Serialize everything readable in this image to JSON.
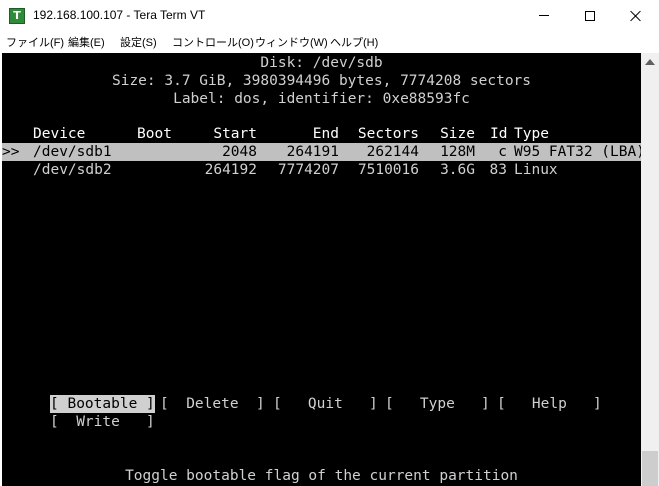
{
  "window": {
    "title": "192.168.100.107 - Tera Term VT",
    "icon_letter": "T"
  },
  "menu": [
    {
      "label": "ファイル(F)"
    },
    {
      "label": "編集(E)"
    },
    {
      "label": "設定(S)"
    },
    {
      "label": "コントロール(O)"
    },
    {
      "label": "ウィンドウ(W)"
    },
    {
      "label": "ヘルプ(H)"
    }
  ],
  "disk": {
    "line1": "Disk: /dev/sdb",
    "line2": "Size: 3.7 GiB, 3980394496 bytes, 7774208 sectors",
    "line3": "Label: dos, identifier: 0xe88593fc"
  },
  "table": {
    "headers": {
      "device": "Device",
      "boot": "Boot",
      "start": "Start",
      "end": "End",
      "sectors": "Sectors",
      "size": "Size",
      "id": "Id",
      "type": "Type"
    },
    "cursor": ">>",
    "rows": [
      {
        "device": "/dev/sdb1",
        "boot": "",
        "start": "2048",
        "end": "264191",
        "sectors": "262144",
        "size": "128M",
        "id": "c",
        "type": "W95 FAT32 (LBA)"
      },
      {
        "device": "/dev/sdb2",
        "boot": "",
        "start": "264192",
        "end": "7774207",
        "sectors": "7510016",
        "size": "3.6G",
        "id": "83",
        "type": "Linux"
      }
    ]
  },
  "actions": {
    "bootable": "[ Bootable ]",
    "delete": "[  Delete  ]",
    "quit": "[   Quit   ]",
    "type": "[   Type   ]",
    "help": "[   Help   ]",
    "write": "[  Write   ]"
  },
  "status": "Toggle bootable flag of the current partition",
  "colors": {
    "terminal_bg": "#000000",
    "terminal_fg": "#d0d0d0",
    "selection_bg": "#c0c0c0"
  }
}
